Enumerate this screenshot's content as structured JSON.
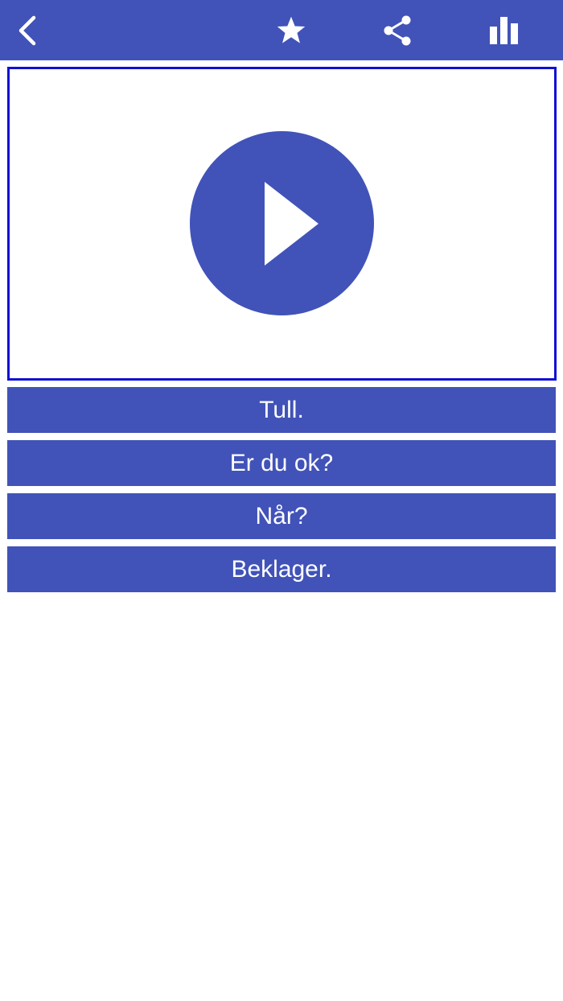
{
  "colors": {
    "accent": "#4153b8",
    "player_border": "#1010d6",
    "background": "#ffffff",
    "text_on_accent": "#ffffff"
  },
  "toolbar": {
    "icons": [
      "chevron-left-icon",
      "star-icon",
      "share-icon",
      "bar-chart-icon"
    ]
  },
  "player": {
    "icon": "play-icon"
  },
  "answers": [
    {
      "label": "Tull."
    },
    {
      "label": "Er du ok?"
    },
    {
      "label": "Når?"
    },
    {
      "label": "Beklager."
    }
  ]
}
